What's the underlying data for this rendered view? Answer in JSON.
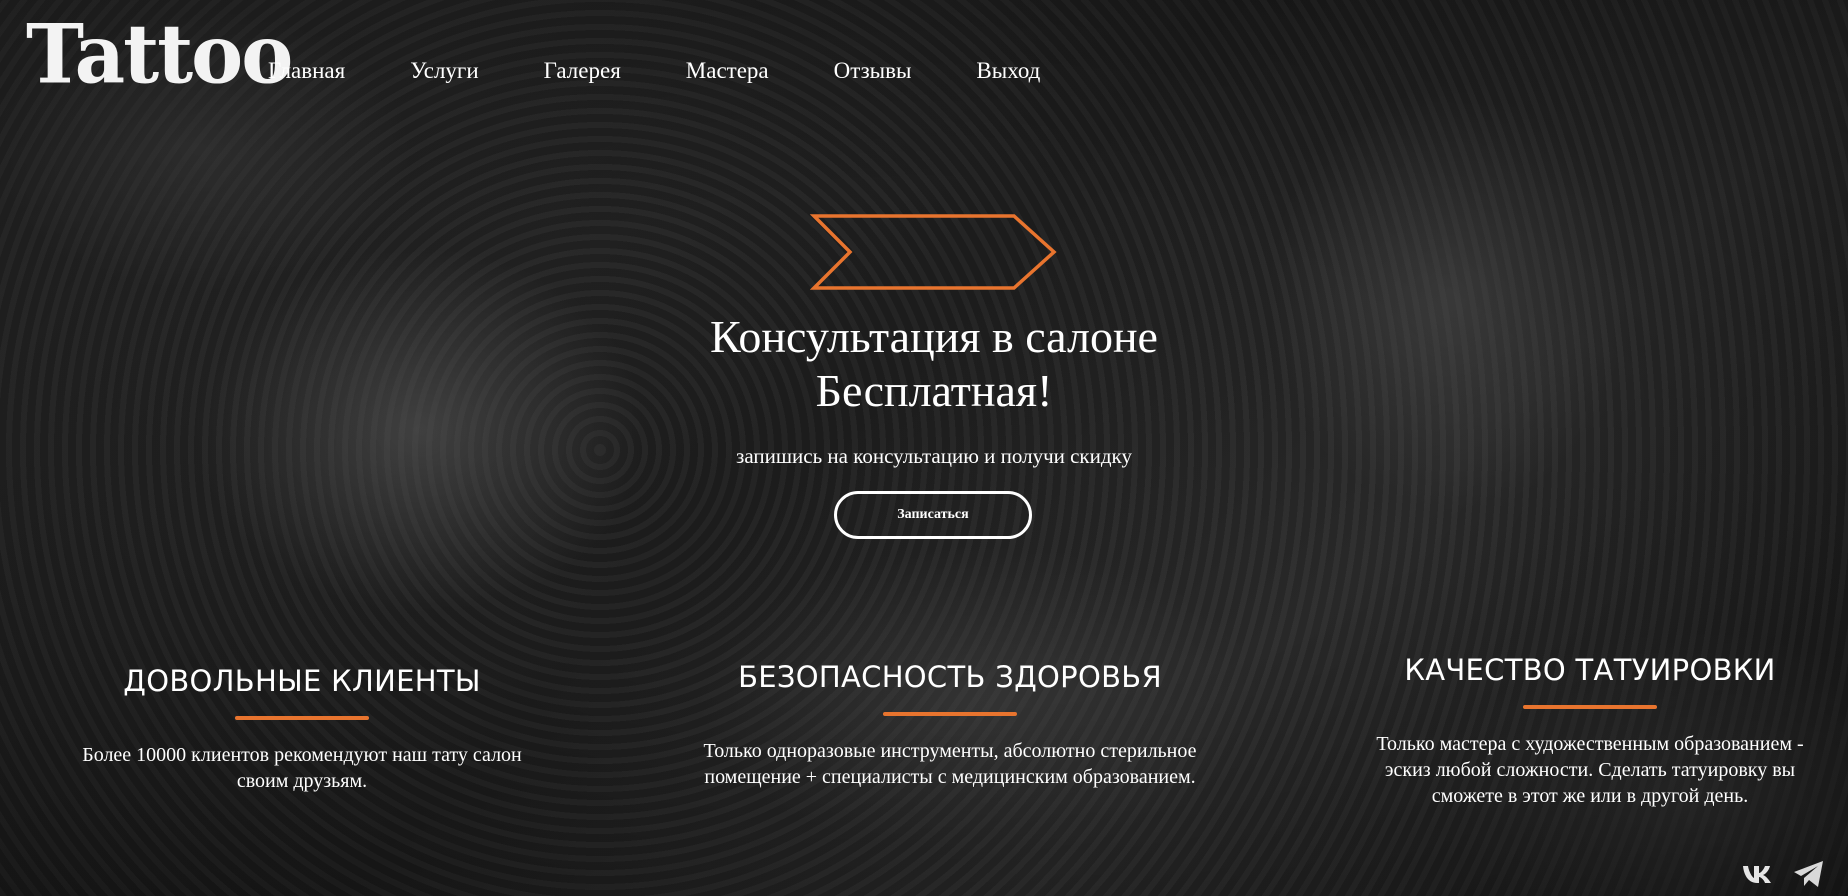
{
  "brand": {
    "logo_text": "Tattoo"
  },
  "nav": {
    "items": [
      {
        "label": "Главная"
      },
      {
        "label": "Услуги"
      },
      {
        "label": "Галерея"
      },
      {
        "label": "Мастера"
      },
      {
        "label": "Отзывы"
      },
      {
        "label": "Выход"
      }
    ]
  },
  "hero": {
    "title_line1": "Консультация в салоне",
    "title_line2": "Бесплатная!",
    "subtitle": "запишись на консультацию и получи скидку",
    "cta_label": "Записаться"
  },
  "features": [
    {
      "title": "ДОВОЛЬНЫЕ КЛИЕНТЫ",
      "text": "Более 10000 клиентов рекомендуют наш тату салон своим друзьям."
    },
    {
      "title": "БЕЗОПАСНОСТЬ ЗДОРОВЬЯ",
      "text": "Только одноразовые инструменты, абсолютно стерильное помещение + специалисты с медицинским образованием."
    },
    {
      "title": "КАЧЕСТВО ТАТУИРОВКИ",
      "text": "Только мастера с художественным образованием - эскиз любой сложности. Сделать татуировку вы сможете в этот же или в другой день."
    }
  ],
  "social": {
    "vk_icon": "vk-icon",
    "telegram_icon": "telegram-icon"
  },
  "colors": {
    "accent": "#e8742e",
    "text": "#ffffff"
  }
}
